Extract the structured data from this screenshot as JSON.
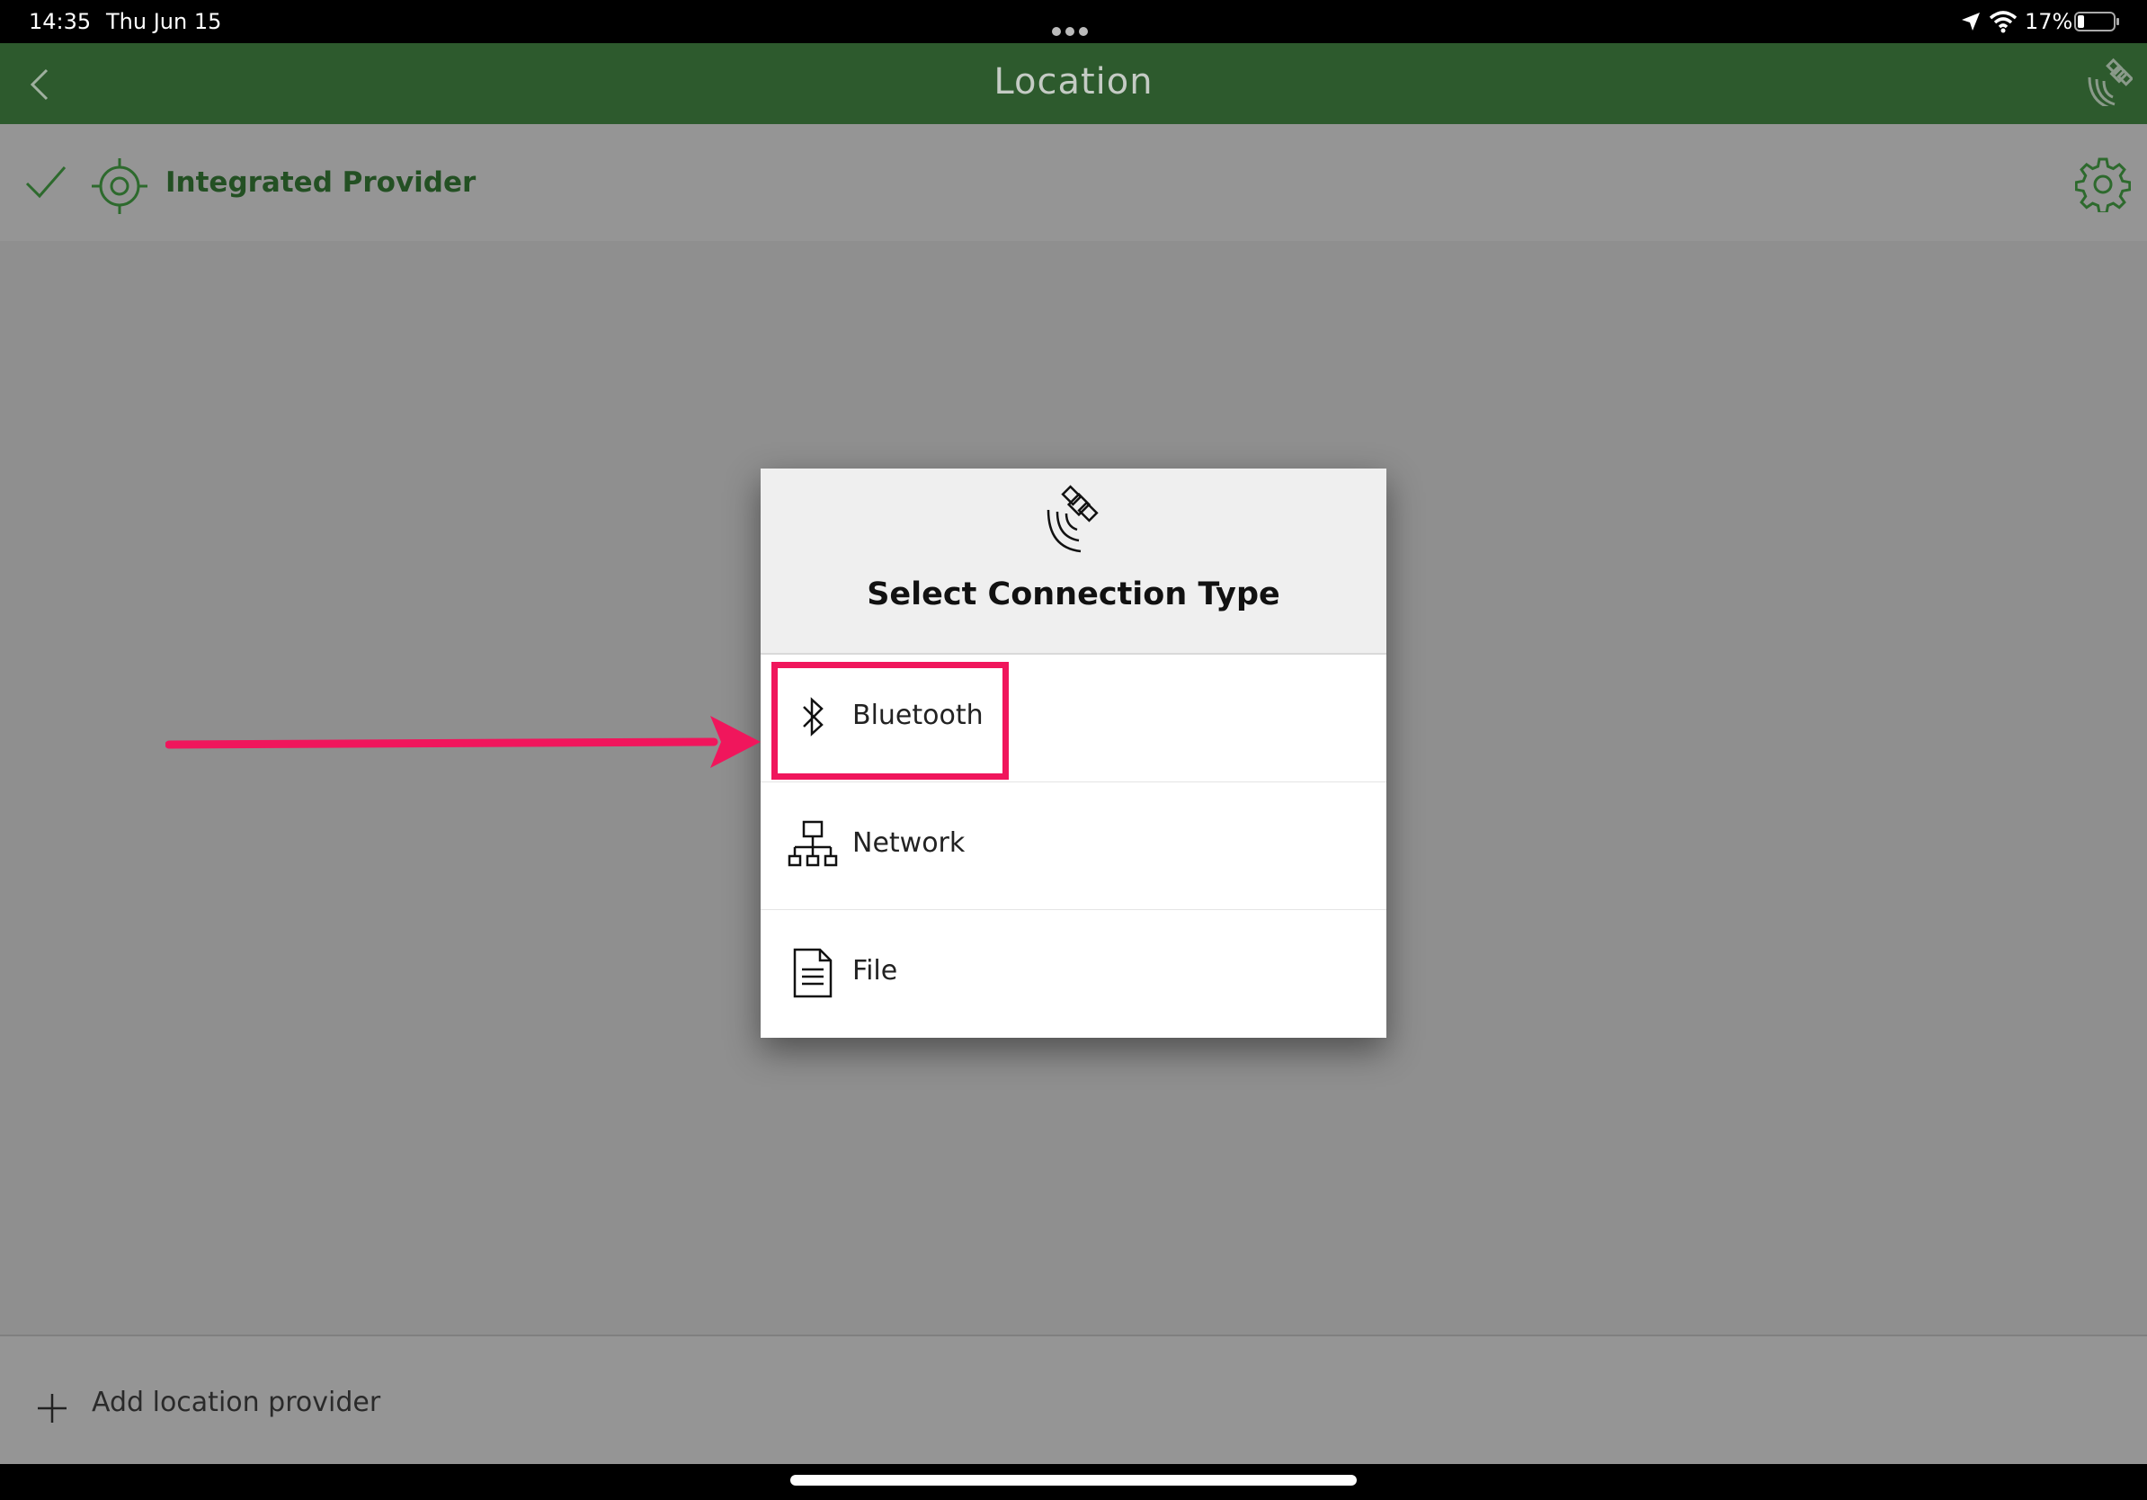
{
  "status_bar": {
    "time": "14:35",
    "date": "Thu Jun 15",
    "battery": "17%"
  },
  "header": {
    "title": "Location",
    "back_icon": "chevron-left-icon",
    "right_icon": "satellite-icon"
  },
  "provider": {
    "name": "Integrated Provider",
    "status_icon": "check-icon",
    "type_icon": "crosshair-target-icon",
    "settings_icon": "gear-icon"
  },
  "dialog": {
    "title": "Select Connection Type",
    "header_icon": "satellite-icon",
    "options": [
      {
        "label": "Bluetooth",
        "icon": "bluetooth-icon"
      },
      {
        "label": "Network",
        "icon": "network-icon"
      },
      {
        "label": "File",
        "icon": "file-icon"
      }
    ]
  },
  "footer": {
    "add_label": "Add location provider",
    "add_icon": "plus-icon"
  },
  "colors": {
    "header_bg": "#2d5a2d",
    "provider_green": "#235023",
    "overlay_gray": "#8f8f8f",
    "highlight": "#f0165c"
  }
}
